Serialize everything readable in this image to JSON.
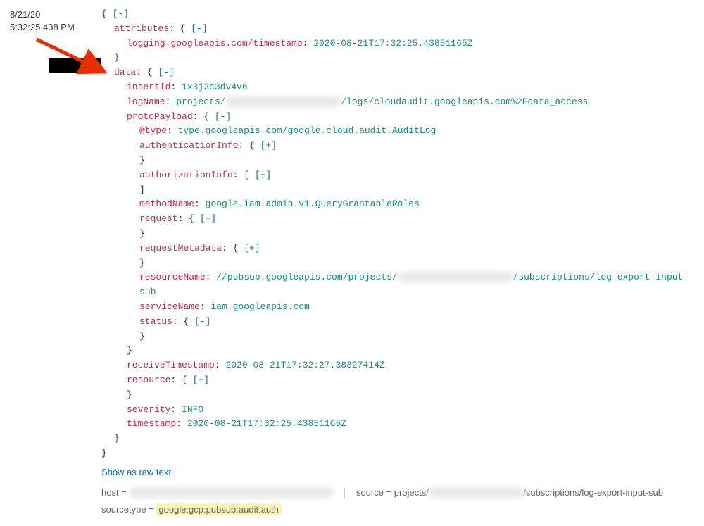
{
  "entry": {
    "date": "8/21/20",
    "time": "5:32:25.438 PM"
  },
  "json": {
    "attributes_key": "attributes",
    "logging_timestamp_key": "logging.googleapis.com/timestamp",
    "logging_timestamp_val": "2020-08-21T17:32:25.43851165Z",
    "data_key": "data",
    "insertId_key": "insertId",
    "insertId_val": "1x3j2c3dv4v6",
    "logName_key": "logName",
    "logName_val_prefix": "projects/",
    "logName_val_suffix": "/logs/cloudaudit.googleapis.com%2Fdata_access",
    "protoPayload_key": "protoPayload",
    "atType_key": "@type",
    "atType_val": "type.googleapis.com/google.cloud.audit.AuditLog",
    "authenticationInfo_key": "authenticationInfo",
    "authorizationInfo_key": "authorizationInfo",
    "methodName_key": "methodName",
    "methodName_val": "google.iam.admin.v1.QueryGrantableRoles",
    "request_key": "request",
    "requestMetadata_key": "requestMetadata",
    "resourceName_key": "resourceName",
    "resourceName_val_prefix": "//pubsub.googleapis.com/projects/",
    "resourceName_val_suffix": "/subscriptions/log-export-input-sub",
    "serviceName_key": "serviceName",
    "serviceName_val": "iam.googleapis.com",
    "status_key": "status",
    "receiveTimestamp_key": "receiveTimestamp",
    "receiveTimestamp_val": "2020-08-21T17:32:27.38327414Z",
    "resource_key": "resource",
    "severity_key": "severity",
    "severity_val": "INFO",
    "timestamp_key": "timestamp",
    "timestamp_val": "2020-08-21T17:32:25.43851165Z"
  },
  "toggles": {
    "collapse": "[-]",
    "expand": "[+]"
  },
  "actions": {
    "show_raw": "Show as raw text"
  },
  "footer": {
    "host_label": "host = ",
    "source_label": "source = ",
    "source_val_prefix": "projects/",
    "source_val_suffix": "/subscriptions/log-export-input-sub",
    "sourcetype_label": "sourcetype = ",
    "sourcetype_val": "google:gcp:pubsub:audit:auth"
  }
}
